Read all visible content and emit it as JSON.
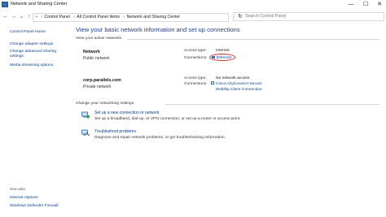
{
  "window": {
    "title": "Network and Sharing Center",
    "controls": {
      "minimize": "—",
      "maximize": "☐",
      "close": "✕"
    }
  },
  "address": {
    "breadcrumbs": [
      "Control Panel",
      "All Control Panel Items",
      "Network and Sharing Center"
    ],
    "search_placeholder": "Search Control Panel"
  },
  "sidebar": {
    "links": [
      "Control Panel Home",
      "Change adapter settings",
      "Change advanced sharing settings",
      "Media streaming options"
    ],
    "see_also_label": "See also",
    "see_also_links": [
      "Internet Options",
      "Windows Defender Firewall"
    ]
  },
  "main": {
    "title": "View your basic network information and set up connections",
    "active_networks_label": "View your active networks",
    "access_type_label": "Access type:",
    "connections_label": "Connections:",
    "networks": [
      {
        "name": "Network",
        "type": "Public network",
        "access_type": "Internet",
        "connection": "Ethernet"
      },
      {
        "name": "corp.parallels.com",
        "type": "Private network",
        "access_type": "No network access",
        "connection_line1": "Cisco AnyConnect Secure",
        "connection_line2": "Mobility Client Connection"
      }
    ],
    "change_settings_label": "Change your networking settings",
    "tasks": [
      {
        "link": "Set up a new connection or network",
        "desc": "Set up a broadband, dial-up, or VPN connection; or set up a router or access point."
      },
      {
        "link": "Troubleshoot problems",
        "desc": "Diagnose and repair network problems, or get troubleshooting information."
      }
    ]
  },
  "colors": {
    "accent": "#1e3f8a",
    "link": "#0a3d91",
    "highlight_circle": "#d42020"
  }
}
